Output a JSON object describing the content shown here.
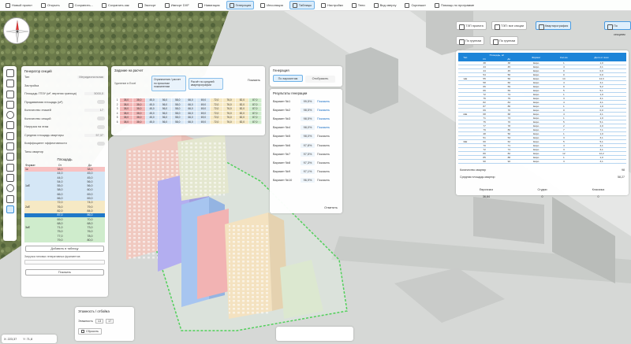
{
  "toolbar": {
    "items": [
      {
        "label": "Новый проект",
        "icon": "new-file-icon"
      },
      {
        "label": "Открыть",
        "icon": "open-folder-icon"
      },
      {
        "label": "Сохранить...",
        "icon": "save-icon"
      },
      {
        "label": "Сохранить как",
        "icon": "save-as-icon"
      },
      {
        "label": "Экспорт",
        "icon": "export-icon"
      },
      {
        "label": "Импорт DXF",
        "icon": "import-icon"
      },
      {
        "label": "Навигация",
        "icon": "navigation-icon"
      },
      {
        "label": "Генерация",
        "icon": "generation-icon",
        "active": true
      },
      {
        "label": "Инсоляция",
        "icon": "sun-icon"
      },
      {
        "label": "Таблицы",
        "icon": "table-icon",
        "active": true
      },
      {
        "label": "Настройки",
        "icon": "settings-icon"
      },
      {
        "label": "Тени",
        "icon": "shadow-icon"
      },
      {
        "label": "Вид сверху",
        "icon": "top-view-icon"
      },
      {
        "label": "Скриншот",
        "icon": "screenshot-icon"
      },
      {
        "label": "Помощь по программе",
        "icon": "help-icon"
      }
    ]
  },
  "generator": {
    "title": "Генератор секций",
    "fields": [
      {
        "label": "Тип",
        "value": "Меридиональная"
      },
      {
        "label": "Застройка",
        "value": ""
      },
      {
        "label": "Площадь ГПЗУ (м², верхняя граница)",
        "value": "5000,0"
      },
      {
        "label": "Продаваемая площадь (м²)",
        "value": ""
      },
      {
        "label": "Количество этажей",
        "value": "17"
      },
      {
        "label": "Количество секций",
        "value": ""
      },
      {
        "label": "Нагрузка на этаж",
        "value": ""
      },
      {
        "label": "Средняя площадь квартиры",
        "value": "57,37"
      },
      {
        "label": "Коэффициент эффективности",
        "value": ""
      },
      {
        "label": "Типы квартир",
        "value": ""
      }
    ],
    "table_title": "Площадь",
    "table_headers": {
      "format": "Формат",
      "from": "От",
      "to": "До"
    },
    "rows": [
      {
        "format": "1к",
        "from": "38,0",
        "to": "38,0",
        "color": "#f8c2c2"
      },
      {
        "format": "",
        "from": "44,0",
        "to": "45,0",
        "color": "#d5e7f6"
      },
      {
        "format": "",
        "from": "44,0",
        "to": "45,0",
        "color": "#d5e7f6"
      },
      {
        "format": "",
        "from": "54,0",
        "to": "56,0",
        "color": "#d5e7f6"
      },
      {
        "format": "1кЕ",
        "from": "55,0",
        "to": "56,0",
        "color": "#d5e7f6"
      },
      {
        "format": "",
        "from": "58,0",
        "to": "60,0",
        "color": "#d5e7f6"
      },
      {
        "format": "",
        "from": "66,0",
        "to": "69,0",
        "color": "#d5e7f6"
      },
      {
        "format": "",
        "from": "66,0",
        "to": "69,0",
        "color": "#d5e7f6"
      },
      {
        "format": "",
        "from": "72,0",
        "to": "74,0",
        "color": "#f6e9c4"
      },
      {
        "format": "2кЕ",
        "from": "76,0",
        "to": "79,0",
        "color": "#f6e9c4"
      },
      {
        "format": "",
        "from": "82,0",
        "to": "84,0",
        "color": "#f6e9c4"
      },
      {
        "format": "",
        "from": "87,0",
        "to": "86,0",
        "color": "#1f78c8"
      },
      {
        "format": "",
        "from": "69,0",
        "to": "70,0",
        "color": "#cfeccc"
      },
      {
        "format": "",
        "from": "68,0",
        "to": "68,0",
        "color": "#cfeccc"
      },
      {
        "format": "3кЕ",
        "from": "71,0",
        "to": "73,0",
        "color": "#cfeccc"
      },
      {
        "format": "",
        "from": "75,0",
        "to": "76,0",
        "color": "#cfeccc"
      },
      {
        "format": "",
        "from": "77,0",
        "to": "78,0",
        "color": "#cfeccc"
      },
      {
        "format": "",
        "from": "79,0",
        "to": "80,0",
        "color": "#cfeccc"
      }
    ],
    "add_button": "Добавить в таблицу",
    "loading_label": "Загрузка типовых генеративных фрагментов",
    "generate_button": "Показать"
  },
  "tasks": {
    "title": "Задание на расчет",
    "options": [
      {
        "label": "Удаление в Excel",
        "selected": false
      },
      {
        "label": "Ограничение / расчет по прошлым показателям",
        "selected": true
      },
      {
        "label": "Расчёт по средней квартирографии",
        "selected": true
      }
    ],
    "show_button": "Показать",
    "grid": [
      [
        "1",
        "38,0",
        "38,0",
        "45,0",
        "56,0",
        "58,0",
        "66,0",
        "69,0",
        "72,0",
        "76,0",
        "82,0",
        "87,0"
      ],
      [
        "2",
        "38,0",
        "38,0",
        "45,0",
        "56,0",
        "58,0",
        "66,0",
        "69,0",
        "72,0",
        "76,0",
        "82,0",
        "87,0"
      ],
      [
        "3",
        "38,0",
        "38,0",
        "45,0",
        "56,0",
        "58,0",
        "66,0",
        "69,0",
        "72,0",
        "76,0",
        "82,0",
        "87,0"
      ],
      [
        "4",
        "38,0",
        "38,0",
        "45,0",
        "56,0",
        "58,0",
        "66,0",
        "69,0",
        "72,0",
        "76,0",
        "82,0",
        "87,0"
      ],
      [
        "5",
        "38,0",
        "38,0",
        "45,0",
        "56,0",
        "58,0",
        "66,0",
        "69,0",
        "72,0",
        "76,0",
        "82,0",
        "87,0"
      ],
      [
        "6",
        "38,0",
        "38,0",
        "45,0",
        "56,0",
        "58,0",
        "66,0",
        "69,0",
        "72,0",
        "76,0",
        "82,0",
        "87,0"
      ]
    ]
  },
  "groups": {
    "title": "Генерация",
    "buttons": [
      "По вариантам",
      "Отобразить"
    ]
  },
  "results": {
    "title": "Результаты генерации",
    "rows": [
      {
        "name": "Вариант №1",
        "pct": "99,5%",
        "action": "Показать"
      },
      {
        "name": "Вариант №2",
        "pct": "98,5%",
        "action": "Показать"
      },
      {
        "name": "Вариант №3",
        "pct": "98,5%",
        "action": "Показать"
      },
      {
        "name": "Вариант №4",
        "pct": "98,0%",
        "action": "Показать"
      },
      {
        "name": "Вариант №5",
        "pct": "98,0%",
        "action": "Показать"
      },
      {
        "name": "Вариант №6",
        "pct": "97,8%",
        "action": "Показать"
      },
      {
        "name": "Вариант №7",
        "pct": "97,5%",
        "action": "Показать"
      },
      {
        "name": "Вариант №8",
        "pct": "97,3%",
        "action": "Показать"
      },
      {
        "name": "Вариант №9",
        "pct": "97,1%",
        "action": "Показать"
      },
      {
        "name": "Вариант №10",
        "pct": "96,9%",
        "action": "Показать"
      }
    ],
    "show_all": "Отметить"
  },
  "right_tabs": [
    {
      "label": "ТЭП проекта",
      "selected": false
    },
    {
      "label": "ТЭП: все секции",
      "selected": false
    },
    {
      "label": "Квартирография",
      "selected": true
    },
    {
      "label": "По группам",
      "selected": false
    },
    {
      "label": "По группам",
      "selected": false
    },
    {
      "label": "По секциям",
      "selected": true
    }
  ],
  "right_table": {
    "headers": [
      "Тип",
      "От",
      "До",
      "Формат",
      "Кол-во",
      "Доля, %"
    ],
    "group_header": "Площадь, м²",
    "share_header": "Доля от всех",
    "rows": [
      [
        "",
        "38",
        "38",
        "Евро",
        "1",
        "1,0"
      ],
      [
        "",
        "44",
        "45",
        "Евро",
        "4",
        "4,1"
      ],
      [
        "",
        "44",
        "45",
        "Евро",
        "0",
        "0,0"
      ],
      [
        "",
        "54",
        "56",
        "Евро",
        "0",
        "0,0"
      ],
      [
        "1кЕ",
        "55",
        "56",
        "Евро",
        "14",
        "14,3"
      ],
      [
        "",
        "58",
        "60",
        "Евро",
        "4",
        "4,1"
      ],
      [
        "",
        "66",
        "69",
        "Евро",
        "9",
        "9,2"
      ],
      [
        "",
        "66",
        "69",
        "Евро",
        "5",
        "5,1"
      ],
      [
        "",
        "72",
        "74",
        "Евро",
        "1",
        "1,0"
      ],
      [
        "",
        "76",
        "79",
        "Евро",
        "3",
        "3,1"
      ],
      [
        "",
        "82",
        "84",
        "Евро",
        "4",
        "4,1"
      ],
      [
        "",
        "87",
        "86",
        "Евро",
        "1",
        "1,0"
      ],
      [
        "",
        "69",
        "70",
        "Евро",
        "0",
        "0,0"
      ],
      [
        "2кЕ",
        "68",
        "68",
        "Евро",
        "4",
        "4,1"
      ],
      [
        "",
        "71",
        "73",
        "Евро",
        "1",
        "1,0"
      ],
      [
        "",
        "75",
        "76",
        "Евро",
        "5",
        "5,1"
      ],
      [
        "",
        "77",
        "78",
        "Евро",
        "2",
        "2,0"
      ],
      [
        "",
        "79",
        "80",
        "Евро",
        "7",
        "7,1"
      ],
      [
        "",
        "48",
        "50",
        "Евро",
        "1",
        "1,0"
      ],
      [
        "",
        "51",
        "53",
        "Евро",
        "3",
        "3,1"
      ],
      [
        "3кЕ",
        "60",
        "62",
        "Евро",
        "5",
        "5,1"
      ],
      [
        "",
        "70",
        "71",
        "Евро",
        "4",
        "4,1"
      ],
      [
        "",
        "72",
        "74",
        "Евро",
        "3",
        "3,1"
      ],
      [
        "",
        "80",
        "82",
        "Евро",
        "12",
        "12,2"
      ],
      [
        "",
        "85",
        "88",
        "Евро",
        "1",
        "1,0"
      ],
      [
        "",
        "90",
        "92",
        "Евро",
        "3",
        "3,1"
      ]
    ],
    "totals": [
      {
        "label": "Количество квартир",
        "value": "98"
      },
      {
        "label": "Средняя площадь квартир",
        "value": "58,27"
      }
    ],
    "bottom": [
      {
        "label": "Евроэскиз",
        "value": "36,84"
      },
      {
        "label": "Студии",
        "value": "0"
      },
      {
        "label": "Классика",
        "value": "0"
      }
    ]
  },
  "floors": {
    "title": "Этажность / отбойка",
    "label": "Этажность",
    "from": "13",
    "to": "17",
    "button": "Сбросить"
  },
  "coords": {
    "x": "X: 223,37",
    "y": "Y: 71,8"
  },
  "colors": {
    "accent": "#1c84d8",
    "rose": "#f2b3b3",
    "lilac": "#b8b4f0",
    "blue": "#a9c9f2",
    "green": "#c9eac4"
  }
}
